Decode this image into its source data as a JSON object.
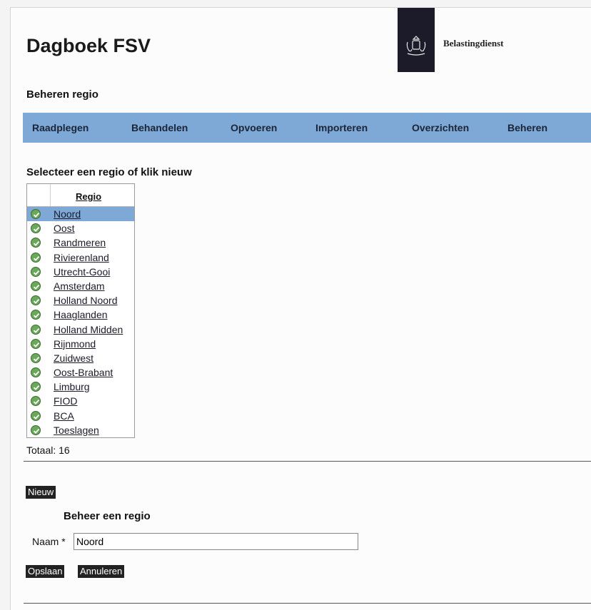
{
  "header": {
    "app_title": "Dagboek FSV",
    "brand": "Belastingdienst",
    "section_title": "Beheren regio"
  },
  "nav": {
    "items": [
      {
        "label": "Raadplegen"
      },
      {
        "label": "Behandelen"
      },
      {
        "label": "Opvoeren"
      },
      {
        "label": "Importeren"
      },
      {
        "label": "Overzichten"
      },
      {
        "label": "Beheren"
      }
    ]
  },
  "list": {
    "heading": "Selecteer een regio of klik nieuw",
    "column_header": "Regio",
    "selected_index": 0,
    "items": [
      "Noord",
      "Oost",
      "Randmeren",
      "Rivierenland",
      "Utrecht-Gooi",
      "Amsterdam",
      "Holland Noord",
      "Haaglanden",
      "Holland Midden",
      "Rijnmond",
      "Zuidwest",
      "Oost-Brabant",
      "Limburg",
      "FIOD",
      "BCA",
      "Toeslagen"
    ],
    "total_label": "Totaal: 16"
  },
  "form": {
    "new_button": "Nieuw",
    "title": "Beheer een regio",
    "naam_label": "Naam *",
    "naam_value": "Noord",
    "save_button": "Opslaan",
    "cancel_button": "Annuleren"
  },
  "colors": {
    "nav_background": "#7ea8d6",
    "selected_row": "#7ea8d6",
    "check_icon": "#6aa85a",
    "logo_block": "#1b1b2a"
  }
}
